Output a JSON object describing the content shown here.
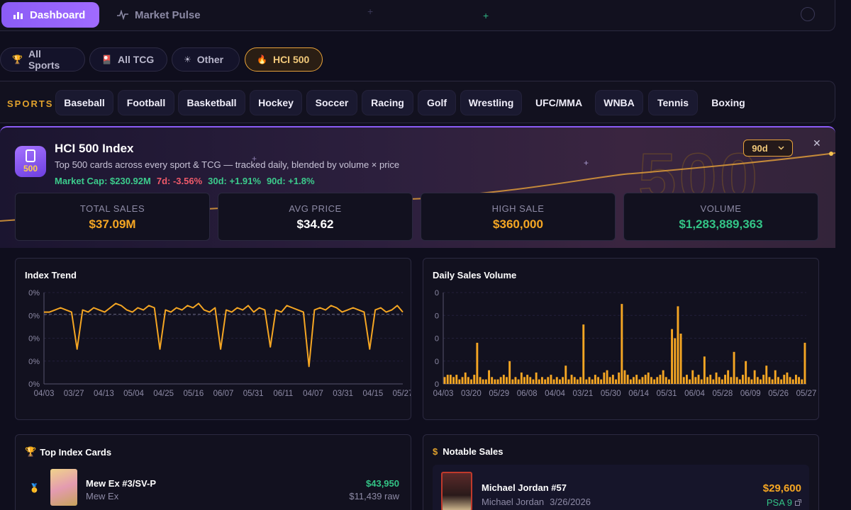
{
  "nav": {
    "dashboard": "Dashboard",
    "market_pulse": "Market Pulse"
  },
  "categories": [
    {
      "label": "All Sports",
      "icon": "trophy-icon"
    },
    {
      "label": "All TCG",
      "icon": "card-icon"
    },
    {
      "label": "Other",
      "icon": "sun-icon"
    },
    {
      "label": "HCI 500",
      "icon": "flame-icon"
    }
  ],
  "sports": {
    "label": "SPORTS",
    "items": [
      "Baseball",
      "Football",
      "Basketball",
      "Hockey",
      "Soccer",
      "Racing",
      "Golf",
      "Wrestling",
      "UFC/MMA",
      "WNBA",
      "Tennis",
      "Boxing"
    ]
  },
  "hero": {
    "icon_text": "500",
    "title": "HCI 500 Index",
    "subtitle": "Top 500 cards across every sport & TCG — tracked daily, blended by volume × price",
    "market_cap": "Market Cap: $230.92M",
    "d7": "7d: -3.56%",
    "d30": "30d: +1.91%",
    "d90": "90d: +1.8%",
    "range": "90d",
    "watermark": "500"
  },
  "stats": [
    {
      "label": "TOTAL SALES",
      "value": "$37.09M"
    },
    {
      "label": "AVG PRICE",
      "value": "$34.62"
    },
    {
      "label": "HIGH SALE",
      "value": "$360,000"
    },
    {
      "label": "VOLUME",
      "value": "$1,283,889,363"
    }
  ],
  "colors": {
    "accent": "#8b5cf6",
    "gold": "#f5a623",
    "green": "#33c486",
    "red": "#f05a6a"
  },
  "chart_data": [
    {
      "type": "line",
      "title": "Index Trend",
      "x_ticks": [
        "04/03",
        "03/27",
        "04/13",
        "05/04",
        "04/25",
        "05/16",
        "06/07",
        "05/31",
        "06/11",
        "04/07",
        "03/31",
        "04/15",
        "05/27"
      ],
      "y_ticks": [
        "0%",
        "0%",
        "0%",
        "0%",
        "0%"
      ],
      "values": [
        0.1,
        0.1,
        0.2,
        0.3,
        0.2,
        0.1,
        -1.6,
        0.2,
        0.1,
        0.3,
        0.2,
        0.1,
        0.3,
        0.5,
        0.4,
        0.2,
        0.1,
        0.3,
        0.2,
        0.4,
        0.3,
        -1.6,
        0.2,
        0.1,
        0.3,
        0.2,
        0.4,
        0.3,
        0.5,
        0.2,
        0.1,
        0.3,
        -1.6,
        0.2,
        0.1,
        0.3,
        0.2,
        0.4,
        0.1,
        0.3,
        0.2,
        -1.5,
        0.2,
        0.1,
        0.4,
        0.3,
        0.2,
        0.1,
        -2.4,
        0.2,
        0.3,
        0.2,
        0.4,
        0.3,
        0.1,
        0.2,
        0.3,
        0.2,
        0.1,
        -1.6,
        0.2,
        0.3,
        0.1,
        0.2,
        0.4,
        0.1
      ]
    },
    {
      "type": "bar",
      "title": "Daily Sales Volume",
      "x_ticks": [
        "04/03",
        "03/20",
        "05/29",
        "06/08",
        "04/04",
        "03/21",
        "05/30",
        "06/14",
        "05/31",
        "06/04",
        "05/28",
        "06/09",
        "05/26",
        "05/27"
      ],
      "y_ticks": [
        "0",
        "0",
        "0",
        "0",
        "0"
      ],
      "values": [
        3,
        4,
        4,
        3,
        4,
        2,
        3,
        5,
        3,
        2,
        4,
        18,
        3,
        2,
        2,
        6,
        3,
        2,
        2,
        3,
        4,
        3,
        10,
        2,
        3,
        2,
        5,
        3,
        4,
        3,
        2,
        5,
        2,
        3,
        2,
        3,
        4,
        2,
        3,
        2,
        3,
        8,
        2,
        4,
        3,
        2,
        3,
        26,
        2,
        3,
        2,
        4,
        3,
        2,
        5,
        6,
        3,
        4,
        2,
        5,
        35,
        6,
        4,
        2,
        3,
        4,
        2,
        3,
        4,
        5,
        3,
        2,
        3,
        4,
        6,
        3,
        2,
        24,
        20,
        34,
        22,
        3,
        4,
        2,
        6,
        3,
        4,
        2,
        12,
        3,
        4,
        2,
        5,
        3,
        2,
        4,
        6,
        3,
        14,
        3,
        2,
        4,
        10,
        3,
        2,
        6,
        3,
        2,
        4,
        8,
        3,
        2,
        6,
        3,
        2,
        4,
        5,
        3,
        2,
        4,
        3,
        2,
        18
      ]
    }
  ],
  "top_cards": {
    "title": "Top Index Cards",
    "items": [
      {
        "name": "Mew Ex #3/SV-P",
        "sub": "Mew Ex",
        "price": "$43,950",
        "raw": "$11,439 raw"
      }
    ]
  },
  "notable_sales": {
    "title": "Notable Sales",
    "items": [
      {
        "name": "Michael Jordan #57",
        "player": "Michael Jordan",
        "date": "3/26/2026",
        "price": "$29,600",
        "grade": "PSA 9"
      }
    ]
  }
}
